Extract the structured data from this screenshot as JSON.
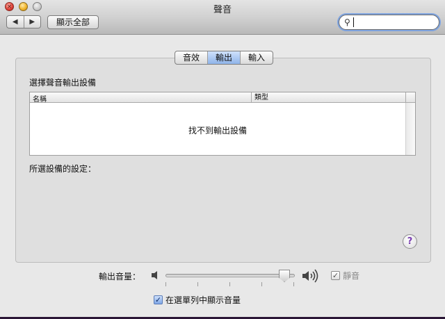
{
  "window": {
    "title": "聲音"
  },
  "toolbar": {
    "back_icon": "◀",
    "forward_icon": "▶",
    "show_all_label": "顯示全部",
    "search_value": ""
  },
  "tabs": [
    {
      "label": "音效",
      "active": false
    },
    {
      "label": "輸出",
      "active": true
    },
    {
      "label": "輸入",
      "active": false
    }
  ],
  "output": {
    "section_label": "選擇聲音輸出設備",
    "columns": {
      "name": "名稱",
      "type": "類型"
    },
    "empty_message": "找不到輸出設備",
    "selected_device_settings_label": "所選設備的設定："
  },
  "help_label": "?",
  "volume": {
    "label": "輸出音量：",
    "level": 0.96,
    "mute_label": "靜音",
    "mute_checked": true,
    "mute_enabled": false,
    "show_in_menu_label": "在選單列中顯示音量",
    "show_in_menu_checked": true
  },
  "colors": {
    "accent": "#8fb4ea",
    "help_accent": "#7a3fb1"
  }
}
